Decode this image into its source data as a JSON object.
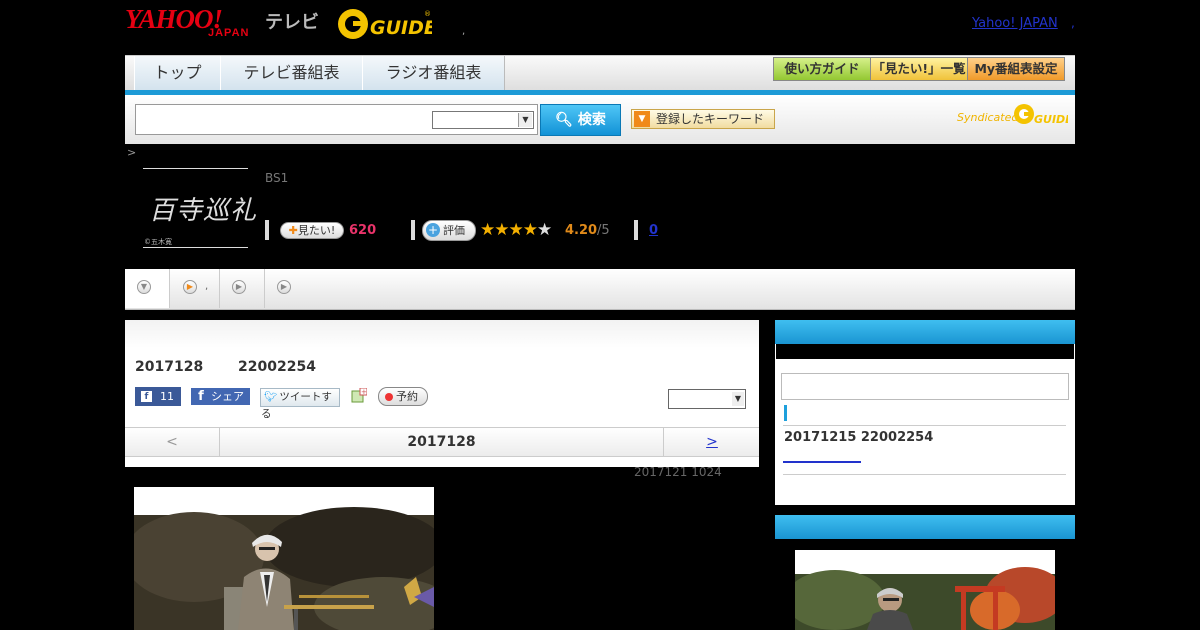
{
  "header": {
    "logo_yahoo": "YAHOO!",
    "logo_japan": "JAPAN",
    "logo_tv": "テレビ",
    "logo_gguide": "G GUIDE",
    "yahoo_japan_link": "Yahoo! JAPAN"
  },
  "nav": {
    "tabs": [
      {
        "label": "トップ"
      },
      {
        "label": "テレビ番組表"
      },
      {
        "label": "ラジオ番組表"
      }
    ],
    "guide_buttons": [
      {
        "label": "使い方ガイド"
      },
      {
        "label": "「見たい!」一覧"
      },
      {
        "label": "My番組表設定"
      }
    ]
  },
  "search": {
    "button_label": "検索",
    "keyword_button_label": "登録したキーワード",
    "syndicated_label": "Syndicated"
  },
  "program": {
    "breadcrumb": ">",
    "logo_title": "百寺巡礼",
    "logo_credit": "©五木寛",
    "channel": "BS1",
    "want_button_label": "見たい!",
    "want_count": "620",
    "rate_button_label": "評価",
    "rating_value": "4.20",
    "rating_max": "/5",
    "comment_count": "0"
  },
  "main": {
    "air_date": "2017128",
    "air_time": "22002254",
    "like_count": "11",
    "share_label": "シェア",
    "tweet_label": "ツイートする",
    "reserve_label": "予約",
    "date_nav": {
      "prev": "<",
      "current": "2017128",
      "next": ">"
    },
    "update_info": "2017121  1024"
  },
  "side": {
    "next_air": "20171215  22002254"
  },
  "colors": {
    "accent_blue": "#1c9ad6",
    "want_pink": "#e9336a",
    "rating_orange": "#e08a1a",
    "link_blue": "#2233cc"
  }
}
